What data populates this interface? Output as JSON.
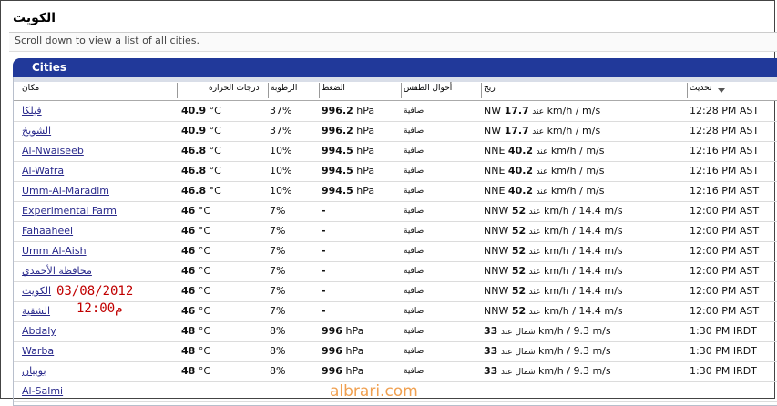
{
  "page": {
    "title": "الكويت",
    "hint": "Scroll down to view a list of all cities.",
    "panel_title": "Cities"
  },
  "columns": {
    "place": "مكان",
    "temp": "درجات الحرارة",
    "humidity": "الرطوبة",
    "pressure": "الضغط",
    "conditions": "أحوال الطقس",
    "wind": "ريح",
    "updated": "تحديث"
  },
  "rows": [
    {
      "city": "فيلكا",
      "temp": "40.9",
      "tunit": "°C",
      "hum": "37%",
      "press": "996.2",
      "punit": "hPa",
      "cond": "صافية",
      "wdir": "NW",
      "wspeed": "17.7",
      "wmid": "عند",
      "wrest": "km/h /  m/s",
      "time": "12:28 PM AST"
    },
    {
      "city": "الشويخ",
      "temp": "40.9",
      "tunit": "°C",
      "hum": "37%",
      "press": "996.2",
      "punit": "hPa",
      "cond": "صافية",
      "wdir": "NW",
      "wspeed": "17.7",
      "wmid": "عند",
      "wrest": "km/h /  m/s",
      "time": "12:28 PM AST"
    },
    {
      "city": "Al-Nwaiseeb",
      "temp": "46.8",
      "tunit": "°C",
      "hum": "10%",
      "press": "994.5",
      "punit": "hPa",
      "cond": "صافية",
      "wdir": "NNE",
      "wspeed": "40.2",
      "wmid": "عند",
      "wrest": "km/h /  m/s",
      "time": "12:16 PM AST"
    },
    {
      "city": "Al-Wafra",
      "temp": "46.8",
      "tunit": "°C",
      "hum": "10%",
      "press": "994.5",
      "punit": "hPa",
      "cond": "صافية",
      "wdir": "NNE",
      "wspeed": "40.2",
      "wmid": "عند",
      "wrest": "km/h /  m/s",
      "time": "12:16 PM AST"
    },
    {
      "city": "Umm-Al-Maradim",
      "temp": "46.8",
      "tunit": "°C",
      "hum": "10%",
      "press": "994.5",
      "punit": "hPa",
      "cond": "صافية",
      "wdir": "NNE",
      "wspeed": "40.2",
      "wmid": "عند",
      "wrest": "km/h /  m/s",
      "time": "12:16 PM AST"
    },
    {
      "city": "Experimental Farm",
      "temp": "46",
      "tunit": "°C",
      "hum": "7%",
      "press": "-",
      "punit": "",
      "cond": "صافية",
      "wdir": "NNW",
      "wspeed": "52",
      "wmid": "عند",
      "wrest": "km/h / 14.4 m/s",
      "time": "12:00 PM AST"
    },
    {
      "city": "Fahaaheel",
      "temp": "46",
      "tunit": "°C",
      "hum": "7%",
      "press": "-",
      "punit": "",
      "cond": "صافية",
      "wdir": "NNW",
      "wspeed": "52",
      "wmid": "عند",
      "wrest": "km/h / 14.4 m/s",
      "time": "12:00 PM AST"
    },
    {
      "city": "Umm Al-Aish",
      "temp": "46",
      "tunit": "°C",
      "hum": "7%",
      "press": "-",
      "punit": "",
      "cond": "صافية",
      "wdir": "NNW",
      "wspeed": "52",
      "wmid": "عند",
      "wrest": "km/h / 14.4 m/s",
      "time": "12:00 PM AST"
    },
    {
      "city": "محافظة الأحمدي",
      "temp": "46",
      "tunit": "°C",
      "hum": "7%",
      "press": "-",
      "punit": "",
      "cond": "صافية",
      "wdir": "NNW",
      "wspeed": "52",
      "wmid": "عند",
      "wrest": "km/h / 14.4 m/s",
      "time": "12:00 PM AST"
    },
    {
      "city": "الكويت",
      "temp": "46",
      "tunit": "°C",
      "hum": "7%",
      "press": "-",
      "punit": "",
      "cond": "صافية",
      "wdir": "NNW",
      "wspeed": "52",
      "wmid": "عند",
      "wrest": "km/h / 14.4 m/s",
      "time": "12:00 PM AST"
    },
    {
      "city": "الشقية",
      "temp": "46",
      "tunit": "°C",
      "hum": "7%",
      "press": "-",
      "punit": "",
      "cond": "صافية",
      "wdir": "NNW",
      "wspeed": "52",
      "wmid": "عند",
      "wrest": "km/h / 14.4 m/s",
      "time": "12:00 PM AST"
    },
    {
      "city": "Abdaly",
      "temp": "48",
      "tunit": "°C",
      "hum": "8%",
      "press": "996",
      "punit": "hPa",
      "cond": "صافية",
      "wdir": "",
      "wspeed": "33",
      "wmid": "شمال عند",
      "wrest": "km/h / 9.3 m/s",
      "time": "1:30 PM IRDT"
    },
    {
      "city": "Warba",
      "temp": "48",
      "tunit": "°C",
      "hum": "8%",
      "press": "996",
      "punit": "hPa",
      "cond": "صافية",
      "wdir": "",
      "wspeed": "33",
      "wmid": "شمال عند",
      "wrest": "km/h / 9.3 m/s",
      "time": "1:30 PM IRDT"
    },
    {
      "city": "بوبيان",
      "temp": "48",
      "tunit": "°C",
      "hum": "8%",
      "press": "996",
      "punit": "hPa",
      "cond": "صافية",
      "wdir": "",
      "wspeed": "33",
      "wmid": "شمال عند",
      "wrest": "km/h / 9.3 m/s",
      "time": "1:30 PM IRDT"
    },
    {
      "city": "Al-Salmi",
      "temp": "",
      "tunit": "",
      "hum": "",
      "press": "",
      "punit": "",
      "cond": "",
      "wdir": "",
      "wspeed": "",
      "wmid": "",
      "wrest": "",
      "time": ""
    }
  ],
  "overlay": {
    "date": "03/08/2012",
    "time": "12:00م",
    "watermark": "albrari.com"
  }
}
